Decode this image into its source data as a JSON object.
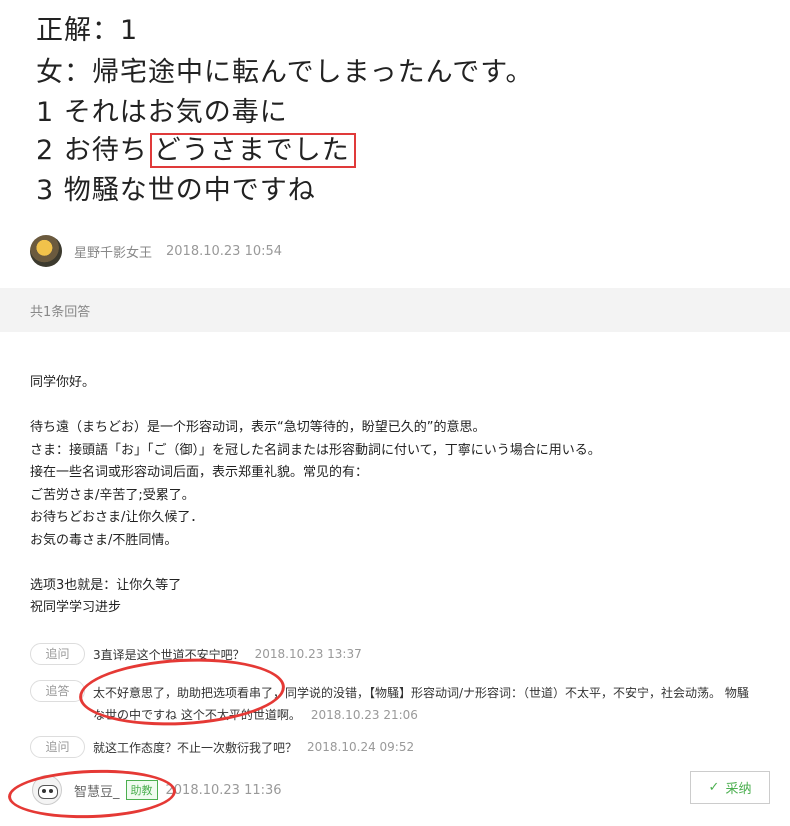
{
  "question": {
    "line1": "正解：1",
    "line2": "女：帰宅途中に転んでしまったんです。",
    "line3": "1 それはお気の毒に",
    "line4_prefix": "2 お待ち",
    "line4_highlight": "どうさまでした",
    "line5": "3 物騒な世の中ですね"
  },
  "question_author": {
    "name": "星野千影女王",
    "time": "2018.10.23 10:54"
  },
  "answer_count": "共1条回答",
  "answer": {
    "lines": [
      "同学你好。",
      "",
      "待ち遠（まちどお）是一个形容动词，表示“急切等待的，盼望已久的”的意思。",
      "さま：接頭語「お」「ご（御）」を冠した名詞または形容動詞に付いて，丁寧にいう場合に用いる。",
      "接在一些名词或形容动词后面，表示郑重礼貌。常见的有：",
      "ご苦労さま/辛苦了;受累了。",
      "お待ちどおさま/让你久候了．",
      "お気の毒さま/不胜同情。",
      "",
      "选项3也就是：让你久等了",
      "祝同学学习进步"
    ]
  },
  "followups": [
    {
      "tag": "追问",
      "text": "3直译是这个世道不安宁吧？",
      "time": "2018.10.23 13:37"
    },
    {
      "tag": "追答",
      "text_line1": "太不好意思了，助助把选项看串了，同学说的没错，【物騒】形容动词/ナ形容词：（世道）不太平，不安宁，社会动荡。 物騒",
      "text_line2": "な世の中ですね 这个不太平的世道啊。",
      "time": "2018.10.23 21:06"
    },
    {
      "tag": "追问",
      "text": "就这工作态度？不止一次敷衍我了吧？",
      "time": "2018.10.24 09:52"
    }
  ],
  "answer_author": {
    "name": "智慧豆_",
    "badge": "助教",
    "time": "2018.10.23 11:36"
  },
  "adopt_button": {
    "label": "采纳",
    "icon": "check-icon"
  },
  "colors": {
    "highlight_red": "#e03a3a",
    "accent_green": "#4caf50",
    "count_bar_bg": "#f3f3f3"
  }
}
